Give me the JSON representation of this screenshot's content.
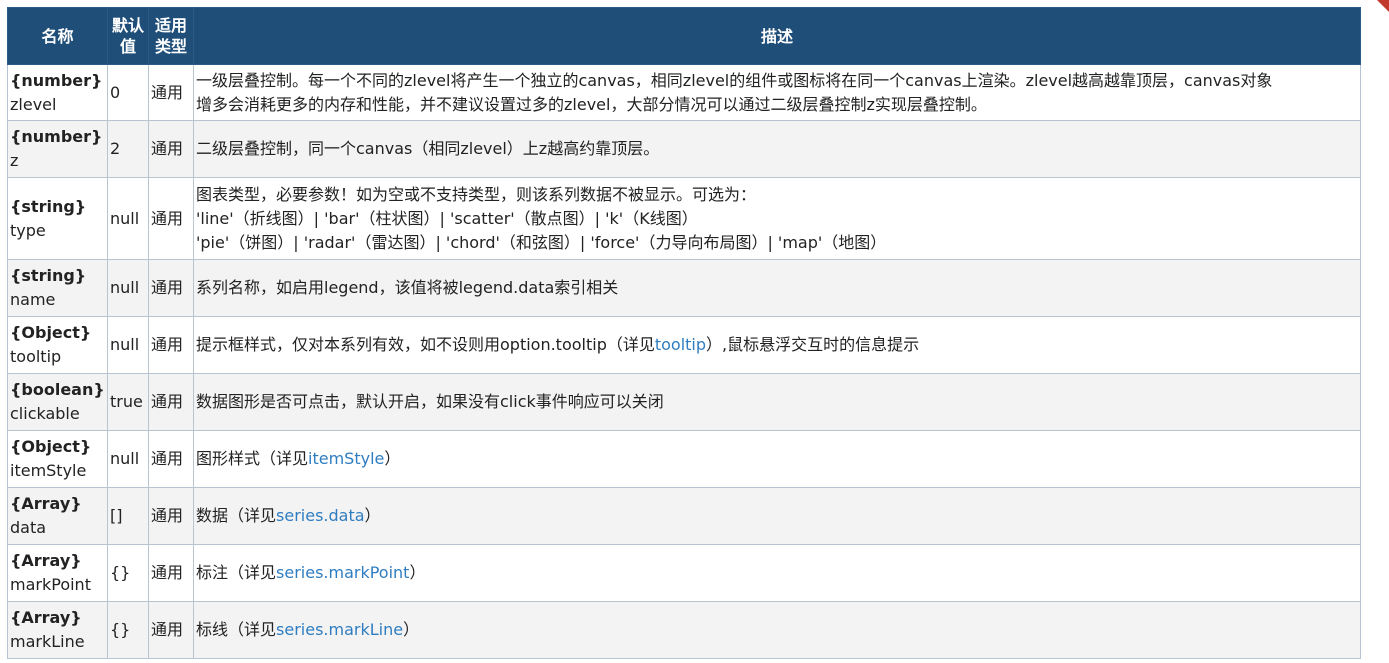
{
  "table": {
    "headers": {
      "name": "名称",
      "default_line1": "默认",
      "default_line2": "值",
      "scope_line1": "适用",
      "scope_line2": "类型",
      "desc": "描述"
    },
    "rows": [
      {
        "type": "{number}",
        "field": "zlevel",
        "default": "0",
        "scope": "通用",
        "desc": [
          "一级层叠控制。每一个不同的zlevel将产生一个独立的canvas，相同zlevel的组件或图标将在同一个canvas上渲染。zlevel越高越靠顶层，canvas对象",
          "增多会消耗更多的内存和性能，并不建议设置过多的zlevel，大部分情况可以通过二级层叠控制z实现层叠控制。"
        ]
      },
      {
        "type": "{number}",
        "field": "z",
        "default": "2",
        "scope": "通用",
        "desc": [
          "二级层叠控制，同一个canvas（相同zlevel）上z越高约靠顶层。"
        ]
      },
      {
        "type": "{string}",
        "field": "type",
        "default": "null",
        "scope": "通用",
        "desc": [
          "图表类型，必要参数！如为空或不支持类型，则该系列数据不被显示。可选为：",
          "'line'（折线图）| 'bar'（柱状图）| 'scatter'（散点图）| 'k'（K线图）",
          "'pie'（饼图）| 'radar'（雷达图）| 'chord'（和弦图）| 'force'（力导向布局图）| 'map'（地图）"
        ]
      },
      {
        "type": "{string}",
        "field": "name",
        "default": "null",
        "scope": "通用",
        "desc": [
          "系列名称，如启用legend，该值将被legend.data索引相关"
        ]
      },
      {
        "type": "{Object}",
        "field": "tooltip",
        "default": "null",
        "scope": "通用",
        "desc_pre": "提示框样式，仅对本系列有效，如不设则用option.tooltip（详见",
        "desc_link": "tooltip",
        "desc_post": "）,鼠标悬浮交互时的信息提示"
      },
      {
        "type": "{boolean}",
        "field": "clickable",
        "default": "true",
        "scope": "通用",
        "desc": [
          "数据图形是否可点击，默认开启，如果没有click事件响应可以关闭"
        ]
      },
      {
        "type": "{Object}",
        "field": "itemStyle",
        "default": "null",
        "scope": "通用",
        "desc_pre": "图形样式（详见",
        "desc_link": "itemStyle",
        "desc_post": "）"
      },
      {
        "type": "{Array}",
        "field": "data",
        "default": "[]",
        "scope": "通用",
        "desc_pre": "数据（详见",
        "desc_link": "series.data",
        "desc_post": "）"
      },
      {
        "type": "{Array}",
        "field": "markPoint",
        "default": "{}",
        "scope": "通用",
        "desc_pre": "标注（详见",
        "desc_link": "series.markPoint",
        "desc_post": "）"
      },
      {
        "type": "{Array}",
        "field": "markLine",
        "default": "{}",
        "scope": "通用",
        "desc_pre": "标线（详见",
        "desc_link": "series.markLine",
        "desc_post": "）"
      }
    ]
  },
  "colors": {
    "header_bg": "#1f4e79",
    "link": "#2f7dc1",
    "corner_accent": "#c0392b"
  }
}
